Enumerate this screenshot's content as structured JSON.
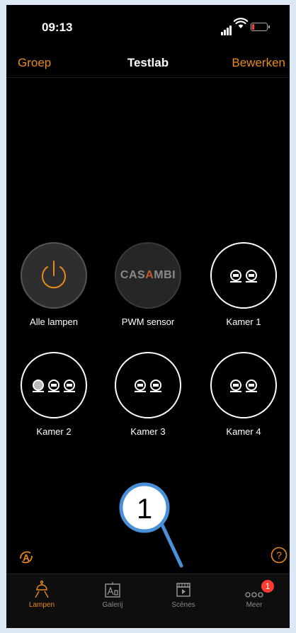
{
  "status_bar": {
    "time": "09:13"
  },
  "navbar": {
    "left_label": "Groep",
    "title": "Testlab",
    "right_label": "Bewerken"
  },
  "tiles": [
    {
      "label": "Alle lampen",
      "icon": "power-icon"
    },
    {
      "label": "PWM sensor",
      "icon": "casambi-logo",
      "logo_text": "CASAMBI"
    },
    {
      "label": "Kamer 1",
      "icon": "lamps-2-icon"
    },
    {
      "label": "Kamer 2",
      "icon": "lamps-3-icon"
    },
    {
      "label": "Kamer 3",
      "icon": "lamps-2-icon"
    },
    {
      "label": "Kamer 4",
      "icon": "lamps-2-icon"
    }
  ],
  "annotation": {
    "number": "1",
    "color": "#4a90d9"
  },
  "tabbar": {
    "tabs": [
      {
        "label": "Lampen",
        "icon": "lamp-icon",
        "active": true
      },
      {
        "label": "Galerij",
        "icon": "gallery-icon"
      },
      {
        "label": "Scènes",
        "icon": "scenes-icon"
      },
      {
        "label": "Meer",
        "icon": "more-icon",
        "badge": "1"
      }
    ]
  },
  "colors": {
    "accent": "#e98a1c",
    "background": "#000000",
    "badge": "#ff3b30"
  }
}
